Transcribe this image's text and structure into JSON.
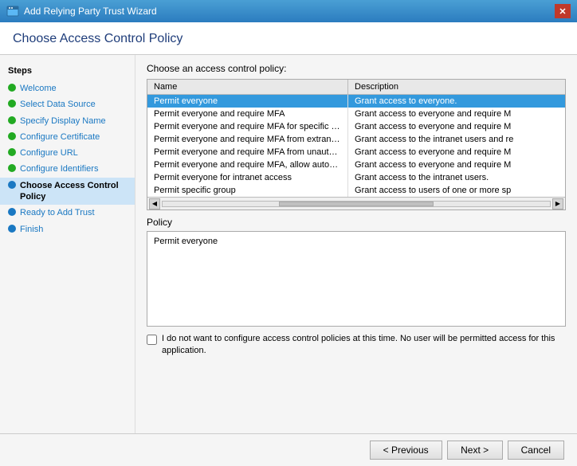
{
  "titleBar": {
    "title": "Add Relying Party Trust Wizard",
    "closeLabel": "✕"
  },
  "dialogHeader": {
    "title": "Choose Access Control Policy"
  },
  "sidebar": {
    "heading": "Steps",
    "items": [
      {
        "id": "welcome",
        "label": "Welcome",
        "dotClass": "dot-green",
        "active": false
      },
      {
        "id": "select-data-source",
        "label": "Select Data Source",
        "dotClass": "dot-green",
        "active": false
      },
      {
        "id": "specify-display-name",
        "label": "Specify Display Name",
        "dotClass": "dot-green",
        "active": false
      },
      {
        "id": "configure-certificate",
        "label": "Configure Certificate",
        "dotClass": "dot-green",
        "active": false
      },
      {
        "id": "configure-url",
        "label": "Configure URL",
        "dotClass": "dot-green",
        "active": false
      },
      {
        "id": "configure-identifiers",
        "label": "Configure Identifiers",
        "dotClass": "dot-green",
        "active": false
      },
      {
        "id": "choose-access-control",
        "label": "Choose Access Control Policy",
        "dotClass": "dot-blue",
        "active": true
      },
      {
        "id": "ready-to-add-trust",
        "label": "Ready to Add Trust",
        "dotClass": "dot-blue",
        "active": false
      },
      {
        "id": "finish",
        "label": "Finish",
        "dotClass": "dot-blue",
        "active": false
      }
    ]
  },
  "mainContent": {
    "sectionLabel": "Choose an access control policy:",
    "tableHeaders": [
      "Name",
      "Description"
    ],
    "tableRows": [
      {
        "name": "Permit everyone",
        "description": "Grant access to everyone.",
        "selected": true
      },
      {
        "name": "Permit everyone and require MFA",
        "description": "Grant access to everyone and require M"
      },
      {
        "name": "Permit everyone and require MFA for specific group",
        "description": "Grant access to everyone and require M"
      },
      {
        "name": "Permit everyone and require MFA from extranet access",
        "description": "Grant access to the intranet users and re"
      },
      {
        "name": "Permit everyone and require MFA from unauthenticated devices",
        "description": "Grant access to everyone and require M"
      },
      {
        "name": "Permit everyone and require MFA, allow automatic device registr...",
        "description": "Grant access to everyone and require M"
      },
      {
        "name": "Permit everyone for intranet access",
        "description": "Grant access to the intranet users."
      },
      {
        "name": "Permit specific group",
        "description": "Grant access to users of one or more sp"
      }
    ],
    "policyLabel": "Policy",
    "policyValue": "Permit everyone",
    "checkboxLabel": "I do not want to configure access control policies at this time. No user will be permitted access for this application."
  },
  "footer": {
    "previousLabel": "< Previous",
    "nextLabel": "Next >",
    "cancelLabel": "Cancel"
  }
}
